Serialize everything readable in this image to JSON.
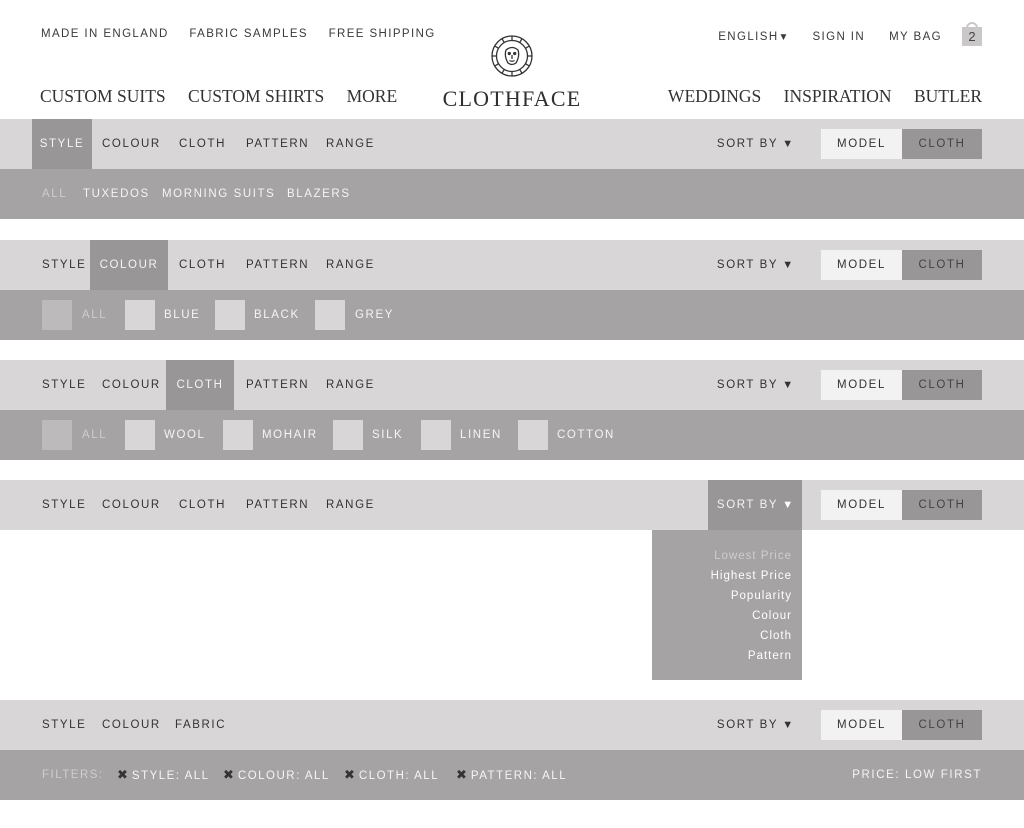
{
  "header": {
    "utility_left": [
      "MADE IN ENGLAND",
      "FABRIC SAMPLES",
      "FREE SHIPPING"
    ],
    "language": "ENGLISH",
    "language_arrow": "▼",
    "sign_in": "SIGN IN",
    "my_bag": "MY BAG",
    "bag_count": "2",
    "nav_left": [
      "CUSTOM SUITS",
      "CUSTOM SHIRTS",
      "MORE"
    ],
    "nav_right": [
      "WEDDINGS",
      "INSPIRATION",
      "BUTLER"
    ],
    "logo_text": "CLOTHFACE",
    "logo_icon": "lion-head-icon"
  },
  "common": {
    "tabs": [
      "STYLE",
      "COLOUR",
      "CLOTH",
      "PATTERN",
      "RANGE"
    ],
    "sort_label": "SORT BY",
    "sort_arrow": "▼",
    "toggle_model": "MODEL",
    "toggle_cloth": "CLOTH"
  },
  "bar1": {
    "active_tab": "STYLE",
    "options": [
      "ALL",
      "TUXEDOS",
      "MORNING SUITS",
      "BLAZERS"
    ]
  },
  "bar2": {
    "active_tab": "COLOUR",
    "options": [
      "ALL",
      "BLUE",
      "BLACK",
      "GREY"
    ]
  },
  "bar3": {
    "active_tab": "CLOTH",
    "options": [
      "ALL",
      "WOOL",
      "MOHAIR",
      "SILK",
      "LINEN",
      "COTTON"
    ]
  },
  "bar4": {
    "active": "SORT BY",
    "sort_options": [
      "Lowest Price",
      "Highest Price",
      "Popularity",
      "Colour",
      "Cloth",
      "Pattern"
    ],
    "selected_sort": "Lowest Price"
  },
  "bar5": {
    "tabs": [
      "STYLE",
      "COLOUR",
      "FABRIC"
    ],
    "filters_label": "FILTERS:",
    "chips": [
      "STYLE: ALL",
      "COLOUR: ALL",
      "CLOTH: ALL",
      "PATTERN: ALL"
    ],
    "chip_remove_glyph": "✖",
    "price_label": "PRICE: LOW FIRST"
  },
  "colors": {
    "bar": "#d9d6d7",
    "active": "#989697",
    "subbar": "#a5a3a4",
    "swatch": "#d8d6d7"
  }
}
